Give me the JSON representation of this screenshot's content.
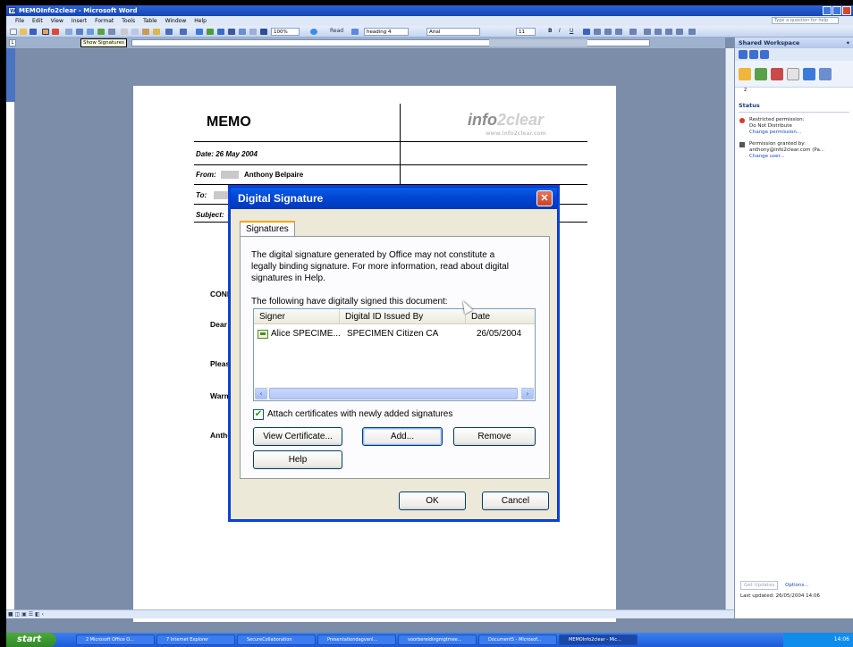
{
  "window": {
    "title": "MEMOInfo2clear - Microsoft Word"
  },
  "menu": {
    "items": [
      "File",
      "Edit",
      "View",
      "Insert",
      "Format",
      "Tools",
      "Table",
      "Window",
      "Help"
    ],
    "help_placeholder": "Type a question for help"
  },
  "toolbar": {
    "zoom": "100%",
    "read_label": "Read",
    "style": "heading 4",
    "font": "Arial",
    "size": "11"
  },
  "ruler": {
    "tooltip": "Show Signatures"
  },
  "document": {
    "memo_title": "MEMO",
    "logo_dark": "info",
    "logo_light": "2clear",
    "logo_url": "www.info2clear.com",
    "date_field": "Date: 26 May 2004",
    "from_label": "From:",
    "from_value": "Anthony Belpaire",
    "to_label": "To:",
    "subject_label": "Subject:",
    "conf_fragment": "CONF",
    "dear_fragment": "Dear S",
    "please_fragment": "Please",
    "warm_fragment": "Warme",
    "anthony_fragment": "Anthor"
  },
  "task_pane": {
    "title": "Shared Workspace",
    "tab_number": "2",
    "status_heading": "Status",
    "restricted_label": "Restricted permission:",
    "restricted_value": "Do Not Distribute",
    "change_permission": "Change permission...",
    "granted_label": "Permission granted by:",
    "granted_value": "anthony@info2clear.com (Pa...",
    "change_user": "Change user...",
    "get_updates": "Get Updates",
    "options": "Options...",
    "last_updated": "Last updated: 26/05/2004 14:06"
  },
  "dialog": {
    "title": "Digital Signature",
    "tab_label": "Signatures",
    "info_line1": "The digital signature generated by Office may not constitute a",
    "info_line2": "legally binding signature. For more information, read about digital",
    "info_line3": "signatures in Help.",
    "signed_label": "The following have digitally signed this document:",
    "columns": [
      "Signer",
      "Digital ID Issued By",
      "Date"
    ],
    "rows": [
      {
        "signer": "Alice SPECIME...",
        "issuer": "SPECIMEN Citizen CA",
        "date": "26/05/2004"
      }
    ],
    "attach_checkbox_label": "Attach certificates with newly added signatures",
    "attach_checked": true,
    "view_certificate": "View Certificate...",
    "add": "Add...",
    "remove": "Remove",
    "help": "Help",
    "ok": "OK",
    "cancel": "Cancel"
  },
  "taskbar": {
    "start": "start",
    "items": [
      "2 Microsoft Office O...",
      "7 Internet Explorer",
      "SecureCollaboration",
      "Presentationdagvanl...",
      "voorbereidingmgtmee...",
      "Document5 - Microsof...",
      "MEMOInfo2clear - Mic..."
    ],
    "clock": "14:06"
  },
  "colors": {
    "xp_blue": "#0a5de8",
    "dialog_face": "#ece9d8",
    "accent_orange": "#f9a500",
    "link_blue": "#1b48b8"
  }
}
